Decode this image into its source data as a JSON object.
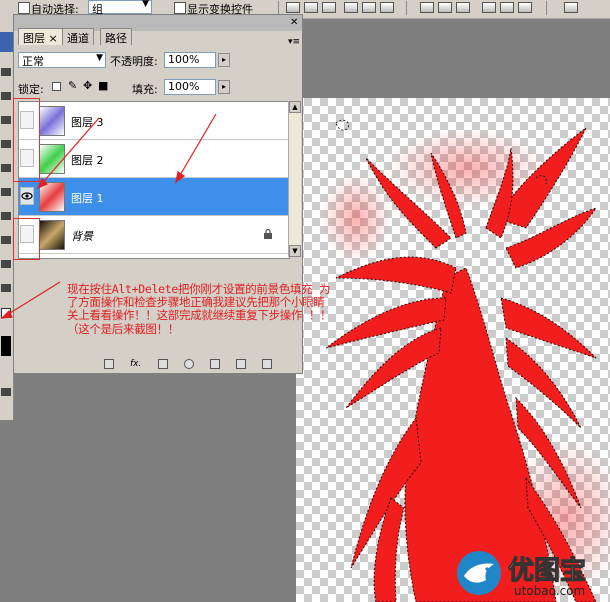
{
  "options_bar": {
    "auto_select_label": "自动选择:",
    "auto_select_value": "组",
    "show_transform_label": "显示变换控件"
  },
  "layers_panel": {
    "tabs": [
      {
        "label": "图层",
        "active": true
      },
      {
        "label": "通道",
        "active": false
      },
      {
        "label": "路径",
        "active": false
      }
    ],
    "close_glyph": "×",
    "blend_mode": "正常",
    "opacity_label": "不透明度:",
    "opacity_value": "100%",
    "lock_label": "锁定:",
    "fill_label": "填充:",
    "fill_value": "100%",
    "layers": [
      {
        "name": "图层 3",
        "visible": false,
        "selected": false,
        "thumb_color": "#7a6fd9"
      },
      {
        "name": "图层 2",
        "visible": false,
        "selected": false,
        "thumb_color": "#3ecf4a"
      },
      {
        "name": "图层 1",
        "visible": true,
        "selected": true,
        "thumb_color": "#e83b3b"
      },
      {
        "name": "背景",
        "visible": false,
        "selected": false,
        "thumb_color": "#c8a86a",
        "locked": true
      }
    ],
    "bottom_icons": [
      "link-icon",
      "fx-icon",
      "mask-icon",
      "adjustment-icon",
      "group-icon",
      "new-layer-icon",
      "trash-icon"
    ],
    "fx_label": "fx."
  },
  "annotation": {
    "text": "现在按住Alt+Delete把你刚才设置的前景色填充 为了方面操作和检查步骤地正确我建议先把那个小眼睛关上看看操作！！这部完成就继续重复下步操作 ！！（这个是后来截图！！",
    "color": "#e02020"
  },
  "watermark": {
    "brand": "优图宝",
    "url": "utobao.com"
  },
  "colors": {
    "selection": "#3e8fea",
    "artwork_red": "#f21d1d",
    "panel_bg": "#d4d0c8"
  }
}
